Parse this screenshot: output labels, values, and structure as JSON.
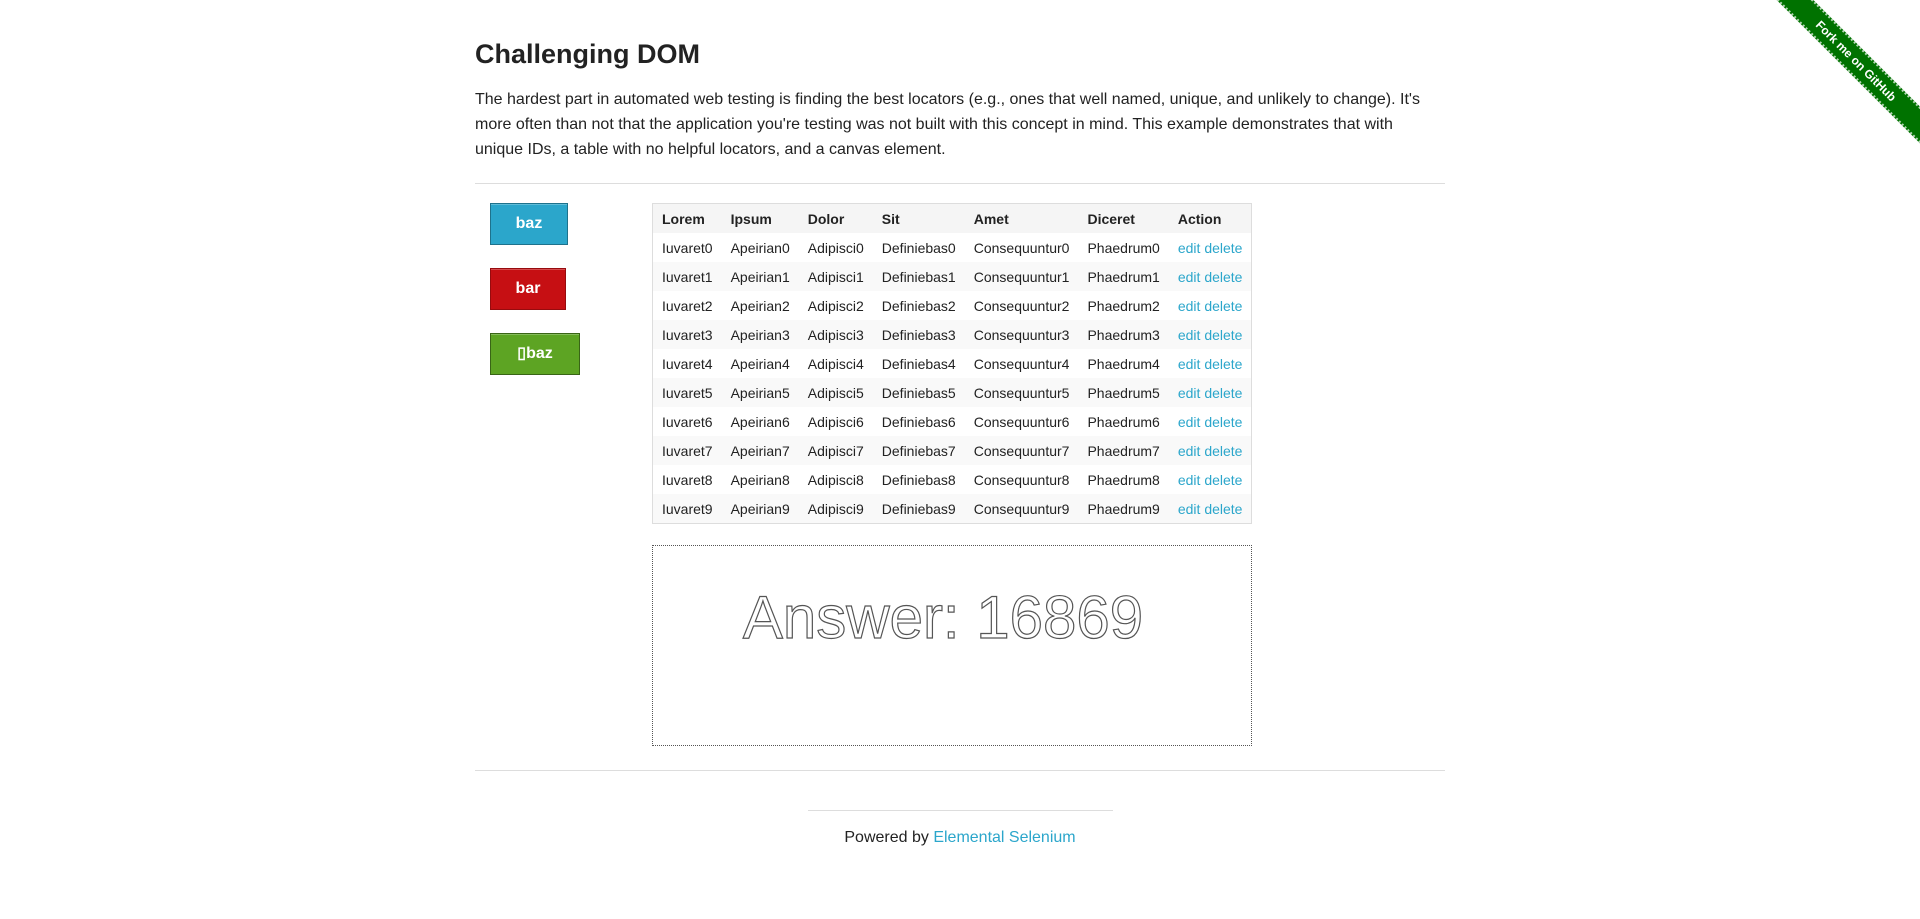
{
  "page": {
    "title": "Challenging DOM",
    "intro": "The hardest part in automated web testing is finding the best locators (e.g., ones that well named, unique, and unlikely to change). It's more often than not that the application you're testing was not built with this concept in mind. This example demonstrates that with unique IDs, a table with no helpful locators, and a canvas element."
  },
  "buttons": [
    {
      "label": "baz",
      "color": "#2ba6cb"
    },
    {
      "label": "bar",
      "color": "#c60f13"
    },
    {
      "label": "baz",
      "icon": "unknown-glyph-icon",
      "color": "#5da423"
    }
  ],
  "table": {
    "headers": [
      "Lorem",
      "Ipsum",
      "Dolor",
      "Sit",
      "Amet",
      "Diceret",
      "Action"
    ],
    "rows": [
      [
        "Iuvaret0",
        "Apeirian0",
        "Adipisci0",
        "Definiebas0",
        "Consequuntur0",
        "Phaedrum0"
      ],
      [
        "Iuvaret1",
        "Apeirian1",
        "Adipisci1",
        "Definiebas1",
        "Consequuntur1",
        "Phaedrum1"
      ],
      [
        "Iuvaret2",
        "Apeirian2",
        "Adipisci2",
        "Definiebas2",
        "Consequuntur2",
        "Phaedrum2"
      ],
      [
        "Iuvaret3",
        "Apeirian3",
        "Adipisci3",
        "Definiebas3",
        "Consequuntur3",
        "Phaedrum3"
      ],
      [
        "Iuvaret4",
        "Apeirian4",
        "Adipisci4",
        "Definiebas4",
        "Consequuntur4",
        "Phaedrum4"
      ],
      [
        "Iuvaret5",
        "Apeirian5",
        "Adipisci5",
        "Definiebas5",
        "Consequuntur5",
        "Phaedrum5"
      ],
      [
        "Iuvaret6",
        "Apeirian6",
        "Adipisci6",
        "Definiebas6",
        "Consequuntur6",
        "Phaedrum6"
      ],
      [
        "Iuvaret7",
        "Apeirian7",
        "Adipisci7",
        "Definiebas7",
        "Consequuntur7",
        "Phaedrum7"
      ],
      [
        "Iuvaret8",
        "Apeirian8",
        "Adipisci8",
        "Definiebas8",
        "Consequuntur8",
        "Phaedrum8"
      ],
      [
        "Iuvaret9",
        "Apeirian9",
        "Adipisci9",
        "Definiebas9",
        "Consequuntur9",
        "Phaedrum9"
      ]
    ],
    "action_edit": "edit",
    "action_delete": "delete"
  },
  "canvas": {
    "text": "Answer: 16869"
  },
  "footer": {
    "prefix": "Powered by ",
    "link": "Elemental Selenium"
  },
  "ribbon": {
    "label": "Fork me on GitHub",
    "color": "#007200"
  },
  "colors": {
    "link": "#2ba6cb",
    "text": "#222222",
    "rule": "#dddddd"
  }
}
